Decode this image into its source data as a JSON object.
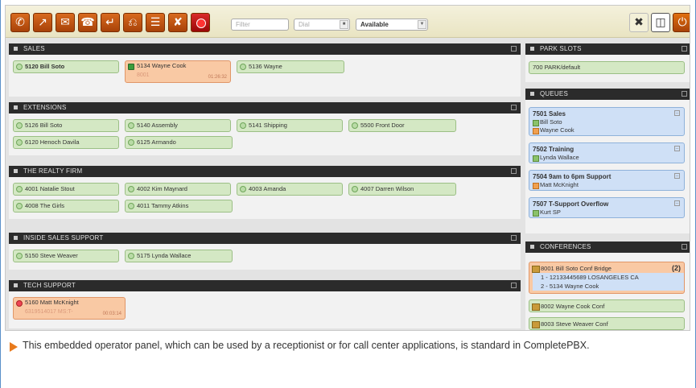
{
  "toolbar": {
    "filter_placeholder": "Filter",
    "dial_placeholder": "Dial",
    "status_value": "Available",
    "icons": [
      "phone-icon",
      "call-transfer-icon",
      "call-voicemail-icon",
      "call-conference-icon",
      "call-pickup-icon",
      "call-park-icon",
      "call-queue-icon",
      "call-hangup-icon",
      "record-icon"
    ],
    "right_icons": [
      "tools-icon",
      "window-icon",
      "power-icon"
    ]
  },
  "sections": {
    "sales": {
      "title": "SALES",
      "cards": [
        {
          "label": "5120 Bill Soto",
          "state": "idle",
          "bold": true
        },
        {
          "label": "5134 Wayne Cook",
          "state": "busy",
          "sub": "8001",
          "time": "01:26:32"
        },
        {
          "label": "5136 Wayne",
          "state": "idle"
        }
      ]
    },
    "extensions": {
      "title": "EXTENSIONS",
      "cards": [
        {
          "label": "5126 Bill Soto"
        },
        {
          "label": "5140 Assembly"
        },
        {
          "label": "5141 Shipping"
        },
        {
          "label": "5500 Front Door"
        },
        {
          "label": "6120 Henoch Davila"
        },
        {
          "label": "6125 Armando"
        }
      ]
    },
    "realty": {
      "title": "THE REALTY FIRM",
      "cards": [
        {
          "label": "4001 Natalie Stout"
        },
        {
          "label": "4002 Kim Maynard"
        },
        {
          "label": "4003 Amanda"
        },
        {
          "label": "4007 Darren Wilson"
        },
        {
          "label": "4008 The Girls"
        },
        {
          "label": "4011 Tammy Atkins"
        }
      ]
    },
    "inside_sales": {
      "title": "INSIDE SALES SUPPORT",
      "cards": [
        {
          "label": "5150 Steve Weaver"
        },
        {
          "label": "5175 Lynda Wallace"
        }
      ]
    },
    "tech": {
      "title": "TECH SUPPORT",
      "cards": [
        {
          "label": "5160 Matt McKnight",
          "state": "busy",
          "sub": "6319514017 MS:T-",
          "time": "00:03:14"
        }
      ]
    }
  },
  "side": {
    "park": {
      "title": "PARK SLOTS",
      "slot": "700 PARK/default"
    },
    "queues": {
      "title": "QUEUES",
      "items": [
        {
          "name": "7501 Sales",
          "members": [
            "Bill Soto",
            "Wayne Cook"
          ]
        },
        {
          "name": "7502 Training",
          "members": [
            "Lynda Wallace"
          ]
        },
        {
          "name": "7504 9am to 6pm Support",
          "members": [
            "Matt McKnight"
          ]
        },
        {
          "name": "7507 T-Support Overflow",
          "members": [
            "Kurt SP"
          ]
        }
      ]
    },
    "conferences": {
      "title": "CONFERENCES",
      "items": [
        {
          "name": "8001 Bill Soto Conf Bridge",
          "count": "(2)",
          "lines": [
            "1 - 12133445689 LOSANGELES CA",
            "2 - 5134 Wayne Cook"
          ]
        },
        {
          "name": "8002 Wayne Cook Conf"
        },
        {
          "name": "8003 Steve Weaver Conf"
        }
      ]
    }
  },
  "caption": "This embedded operator panel, which can be used by a receptionist or for call center applications, is standard in CompletePBX.",
  "colors": {
    "accent": "#e87a1c",
    "frame": "#5a8fc9",
    "header": "#2b2b2b",
    "idle": "#d4e8c4",
    "busy": "#f9c9a4",
    "queue": "#cfe0f6"
  }
}
